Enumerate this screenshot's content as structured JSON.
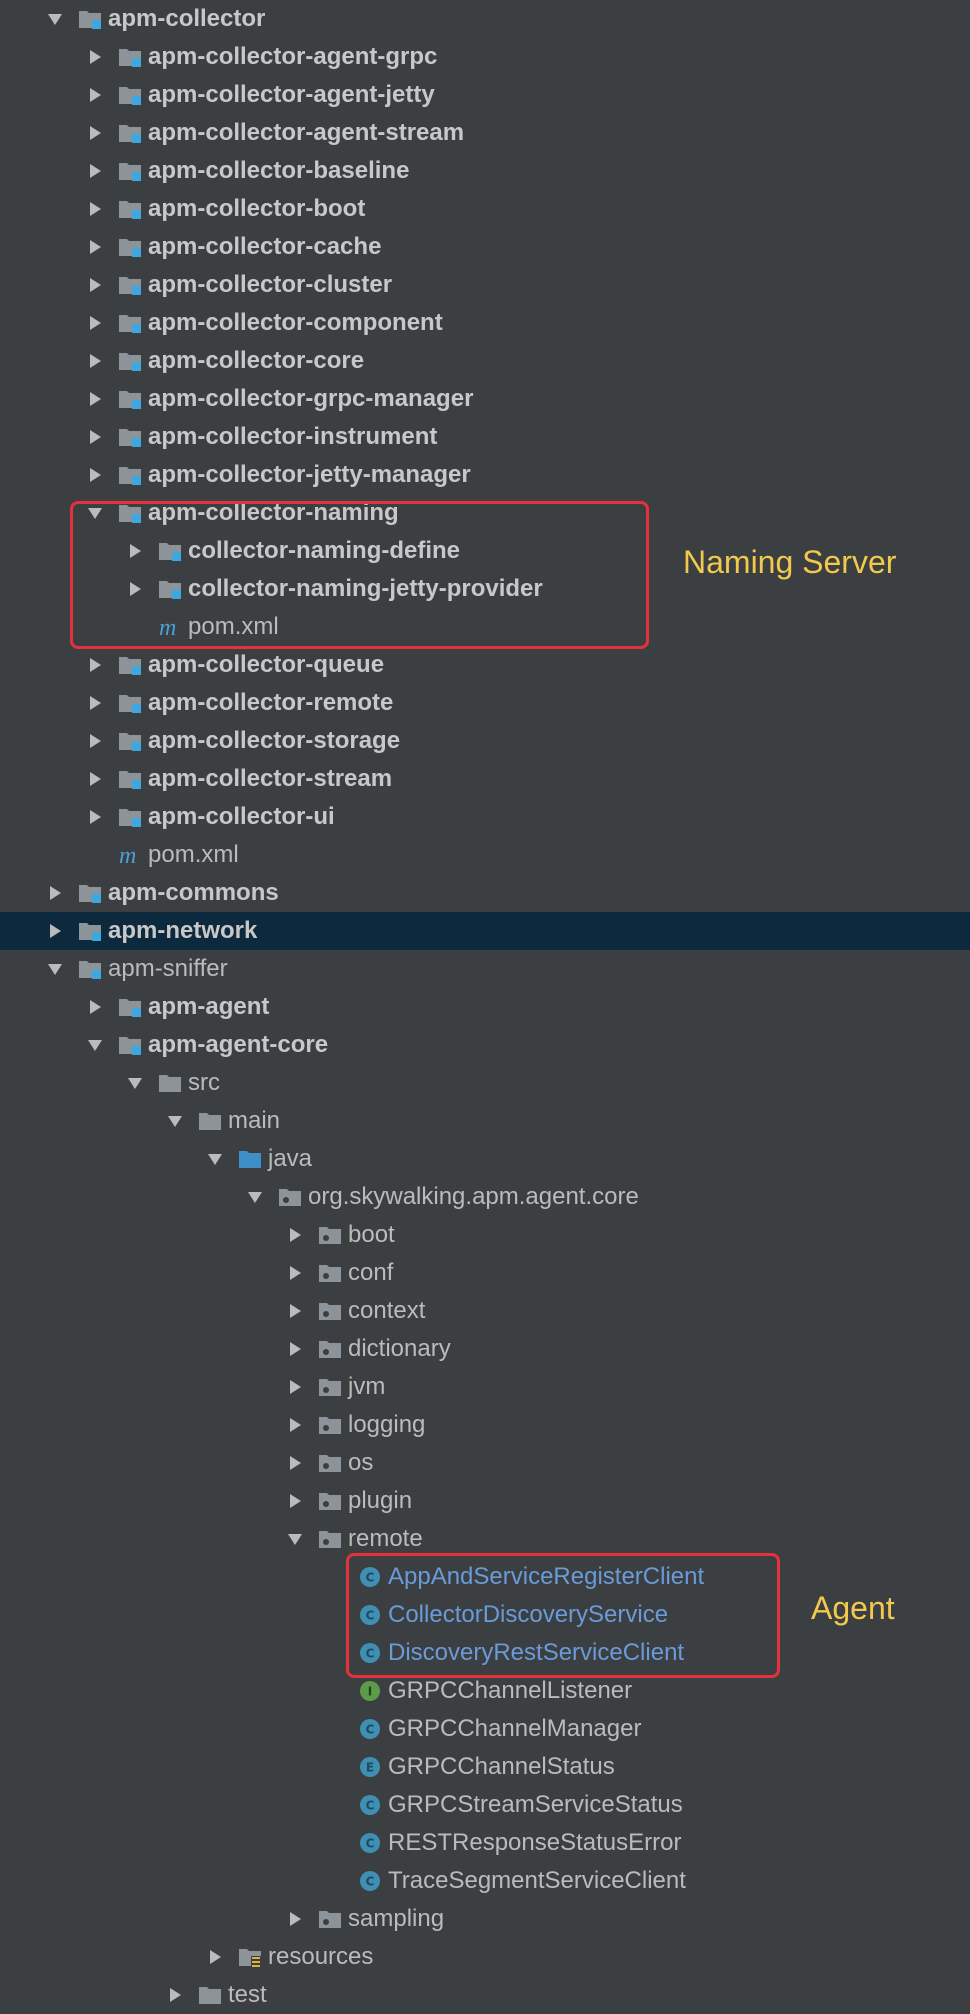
{
  "tree": [
    {
      "label": "apm-collector",
      "indent": 0,
      "arrow": "down",
      "icon": "module-folder-icon",
      "bold": true
    },
    {
      "label": "apm-collector-agent-grpc",
      "indent": 1,
      "arrow": "right",
      "icon": "module-folder-icon",
      "bold": true
    },
    {
      "label": "apm-collector-agent-jetty",
      "indent": 1,
      "arrow": "right",
      "icon": "module-folder-icon",
      "bold": true
    },
    {
      "label": "apm-collector-agent-stream",
      "indent": 1,
      "arrow": "right",
      "icon": "module-folder-icon",
      "bold": true
    },
    {
      "label": "apm-collector-baseline",
      "indent": 1,
      "arrow": "right",
      "icon": "module-folder-icon",
      "bold": true
    },
    {
      "label": "apm-collector-boot",
      "indent": 1,
      "arrow": "right",
      "icon": "module-folder-icon",
      "bold": true
    },
    {
      "label": "apm-collector-cache",
      "indent": 1,
      "arrow": "right",
      "icon": "module-folder-icon",
      "bold": true
    },
    {
      "label": "apm-collector-cluster",
      "indent": 1,
      "arrow": "right",
      "icon": "module-folder-icon",
      "bold": true
    },
    {
      "label": "apm-collector-component",
      "indent": 1,
      "arrow": "right",
      "icon": "module-folder-icon",
      "bold": true
    },
    {
      "label": "apm-collector-core",
      "indent": 1,
      "arrow": "right",
      "icon": "module-folder-icon",
      "bold": true
    },
    {
      "label": "apm-collector-grpc-manager",
      "indent": 1,
      "arrow": "right",
      "icon": "module-folder-icon",
      "bold": true
    },
    {
      "label": "apm-collector-instrument",
      "indent": 1,
      "arrow": "right",
      "icon": "module-folder-icon",
      "bold": true
    },
    {
      "label": "apm-collector-jetty-manager",
      "indent": 1,
      "arrow": "right",
      "icon": "module-folder-icon",
      "bold": true
    },
    {
      "label": "apm-collector-naming",
      "indent": 1,
      "arrow": "down",
      "icon": "module-folder-icon",
      "bold": true
    },
    {
      "label": "collector-naming-define",
      "indent": 2,
      "arrow": "right",
      "icon": "module-folder-icon",
      "bold": true
    },
    {
      "label": "collector-naming-jetty-provider",
      "indent": 2,
      "arrow": "right",
      "icon": "module-folder-icon",
      "bold": true
    },
    {
      "label": "pom.xml",
      "indent": 2,
      "arrow": "none",
      "icon": "maven-icon",
      "bold": false
    },
    {
      "label": "apm-collector-queue",
      "indent": 1,
      "arrow": "right",
      "icon": "module-folder-icon",
      "bold": true
    },
    {
      "label": "apm-collector-remote",
      "indent": 1,
      "arrow": "right",
      "icon": "module-folder-icon",
      "bold": true
    },
    {
      "label": "apm-collector-storage",
      "indent": 1,
      "arrow": "right",
      "icon": "module-folder-icon",
      "bold": true
    },
    {
      "label": "apm-collector-stream",
      "indent": 1,
      "arrow": "right",
      "icon": "module-folder-icon",
      "bold": true
    },
    {
      "label": "apm-collector-ui",
      "indent": 1,
      "arrow": "right",
      "icon": "module-folder-icon",
      "bold": true
    },
    {
      "label": "pom.xml",
      "indent": 1,
      "arrow": "none",
      "icon": "maven-icon",
      "bold": false
    },
    {
      "label": "apm-commons",
      "indent": 0,
      "arrow": "right",
      "icon": "module-folder-icon",
      "bold": true
    },
    {
      "label": "apm-network",
      "indent": 0,
      "arrow": "right",
      "icon": "module-folder-icon",
      "bold": true,
      "selected": true
    },
    {
      "label": "apm-sniffer",
      "indent": 0,
      "arrow": "down",
      "icon": "module-folder-icon",
      "bold": false
    },
    {
      "label": "apm-agent",
      "indent": 1,
      "arrow": "right",
      "icon": "module-folder-icon",
      "bold": true
    },
    {
      "label": "apm-agent-core",
      "indent": 1,
      "arrow": "down",
      "icon": "module-folder-icon",
      "bold": true
    },
    {
      "label": "src",
      "indent": 2,
      "arrow": "down",
      "icon": "folder-icon",
      "bold": false
    },
    {
      "label": "main",
      "indent": 3,
      "arrow": "down",
      "icon": "folder-icon",
      "bold": false
    },
    {
      "label": "java",
      "indent": 4,
      "arrow": "down",
      "icon": "source-folder-icon",
      "bold": false
    },
    {
      "label": "org.skywalking.apm.agent.core",
      "indent": 5,
      "arrow": "down",
      "icon": "package-icon",
      "bold": false
    },
    {
      "label": "boot",
      "indent": 6,
      "arrow": "right",
      "icon": "package-icon",
      "bold": false
    },
    {
      "label": "conf",
      "indent": 6,
      "arrow": "right",
      "icon": "package-icon",
      "bold": false
    },
    {
      "label": "context",
      "indent": 6,
      "arrow": "right",
      "icon": "package-icon",
      "bold": false
    },
    {
      "label": "dictionary",
      "indent": 6,
      "arrow": "right",
      "icon": "package-icon",
      "bold": false
    },
    {
      "label": "jvm",
      "indent": 6,
      "arrow": "right",
      "icon": "package-icon",
      "bold": false
    },
    {
      "label": "logging",
      "indent": 6,
      "arrow": "right",
      "icon": "package-icon",
      "bold": false
    },
    {
      "label": "os",
      "indent": 6,
      "arrow": "right",
      "icon": "package-icon",
      "bold": false
    },
    {
      "label": "plugin",
      "indent": 6,
      "arrow": "right",
      "icon": "package-icon",
      "bold": false
    },
    {
      "label": "remote",
      "indent": 6,
      "arrow": "down",
      "icon": "package-icon",
      "bold": false
    },
    {
      "label": "AppAndServiceRegisterClient",
      "indent": 7,
      "arrow": "none",
      "icon": "class-icon",
      "bold": false,
      "link": true
    },
    {
      "label": "CollectorDiscoveryService",
      "indent": 7,
      "arrow": "none",
      "icon": "class-icon",
      "bold": false,
      "link": true
    },
    {
      "label": "DiscoveryRestServiceClient",
      "indent": 7,
      "arrow": "none",
      "icon": "class-icon",
      "bold": false,
      "link": true
    },
    {
      "label": "GRPCChannelListener",
      "indent": 7,
      "arrow": "none",
      "icon": "interface-icon",
      "bold": false
    },
    {
      "label": "GRPCChannelManager",
      "indent": 7,
      "arrow": "none",
      "icon": "class-icon",
      "bold": false
    },
    {
      "label": "GRPCChannelStatus",
      "indent": 7,
      "arrow": "none",
      "icon": "enum-icon",
      "bold": false
    },
    {
      "label": "GRPCStreamServiceStatus",
      "indent": 7,
      "arrow": "none",
      "icon": "class-icon",
      "bold": false
    },
    {
      "label": "RESTResponseStatusError",
      "indent": 7,
      "arrow": "none",
      "icon": "class-icon",
      "bold": false
    },
    {
      "label": "TraceSegmentServiceClient",
      "indent": 7,
      "arrow": "none",
      "icon": "class-icon",
      "bold": false
    },
    {
      "label": "sampling",
      "indent": 6,
      "arrow": "right",
      "icon": "package-icon",
      "bold": false
    },
    {
      "label": "resources",
      "indent": 4,
      "arrow": "right",
      "icon": "resources-folder-icon",
      "bold": false
    },
    {
      "label": "test",
      "indent": 3,
      "arrow": "right",
      "icon": "folder-icon",
      "bold": false
    }
  ],
  "annotations": {
    "naming": "Naming Server",
    "agent": "Agent"
  },
  "colors": {
    "background": "#3c3f41",
    "text": "#bbbbbb",
    "selected_row": "#0d293e",
    "highlight_box": "#e5313d",
    "annotation_text": "#f2c94c",
    "class_icon": "#3f8fb4",
    "interface_icon": "#5d9b4a"
  }
}
